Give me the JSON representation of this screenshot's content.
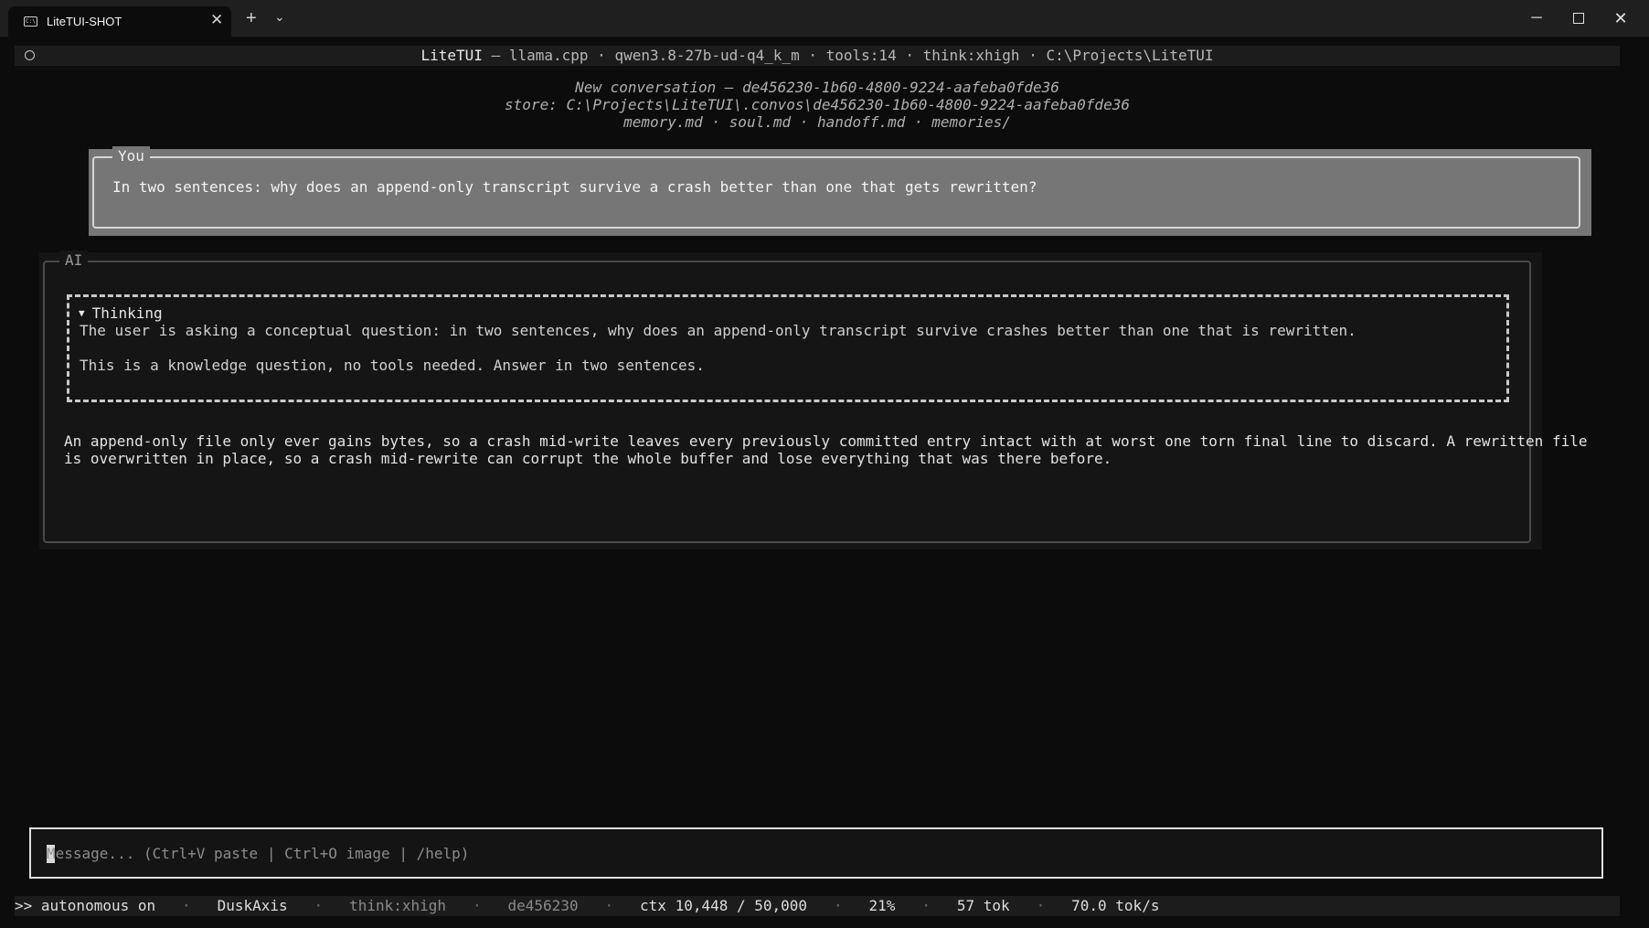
{
  "window": {
    "tab_title": "LiteTUI-SHOT",
    "tab_icon_text": "C:\\",
    "close_glyph": "✕",
    "new_tab_glyph": "+",
    "dropdown_glyph": "⌄",
    "minimize_glyph": "─",
    "close_window_glyph": "✕"
  },
  "header": {
    "app": "LiteTUI",
    "rest": " — llama.cpp · qwen3.8-27b-ud-q4_k_m · tools:14 · think:xhigh · C:\\Projects\\LiteTUI"
  },
  "conversation": {
    "title": "New conversation — de456230-1b60-4800-9224-aafeba0fde36",
    "store": "store: C:\\Projects\\LiteTUI\\.convos\\de456230-1b60-4800-9224-aafeba0fde36",
    "files": "memory.md · soul.md · handoff.md · memories/"
  },
  "user_message": {
    "label": "You",
    "text": "In two sentences: why does an append-only transcript survive a crash better than one that gets rewritten?"
  },
  "ai_message": {
    "label": "AI",
    "thinking": {
      "toggle_glyph": "▼",
      "title": "Thinking",
      "line1": "The user is asking a conceptual question: in two sentences, why does an append-only transcript survive crashes better than one that is rewritten.",
      "line2": "This is a knowledge question, no tools needed. Answer in two sentences."
    },
    "answer_line1": "An append-only file only ever gains bytes, so a crash mid-write leaves every previously committed entry intact with at worst one torn final line to discard. A rewritten file",
    "answer_line2": "is overwritten in place, so a crash mid-rewrite can corrupt the whole buffer and lose everything that was there before."
  },
  "input": {
    "placeholder": "Message... (Ctrl+V paste | Ctrl+O image | /help)",
    "value": ""
  },
  "status": {
    "mode": ">> autonomous on",
    "sep": "·",
    "persona": "DuskAxis",
    "think": "think:xhigh",
    "session": "de456230",
    "ctx": "ctx 10,448 / 50,000",
    "percent": "21%",
    "tokens": "57 tok",
    "speed": "70.0 tok/s"
  }
}
